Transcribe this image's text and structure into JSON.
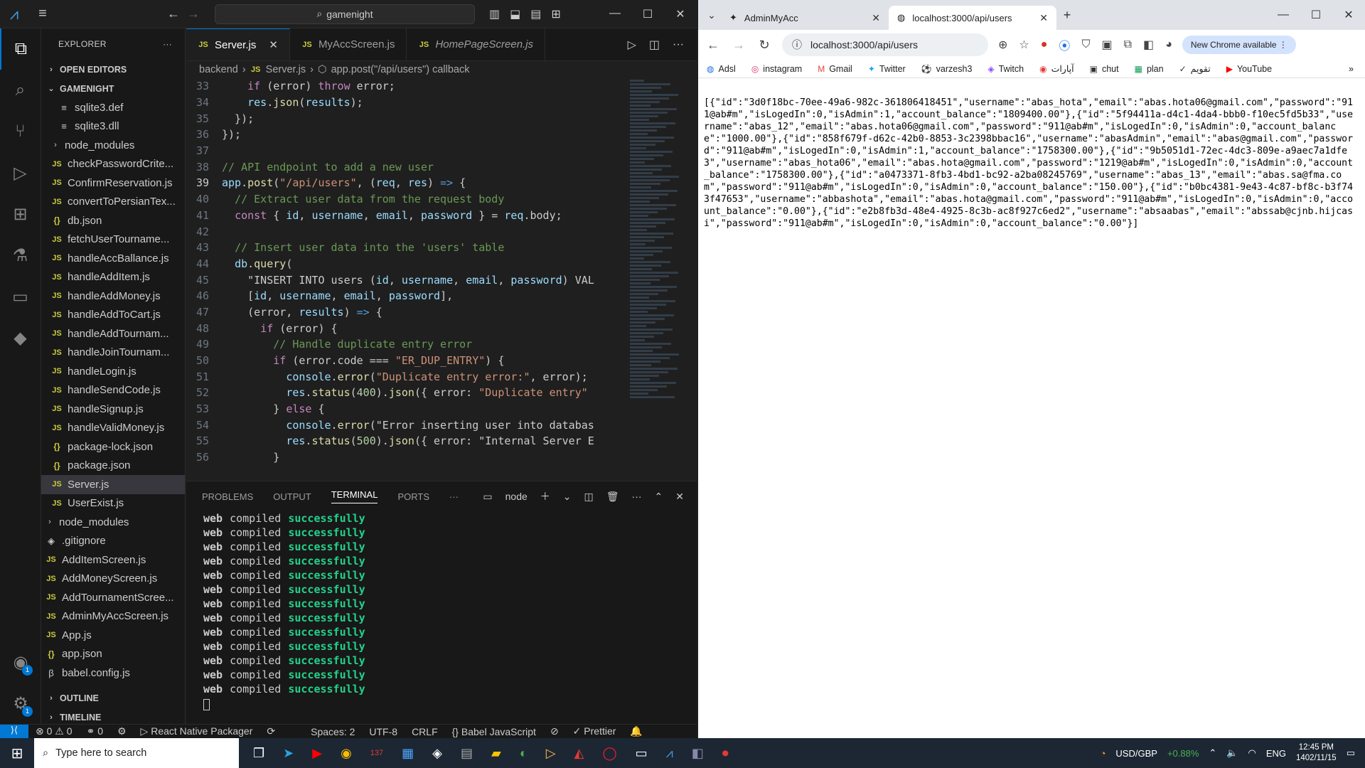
{
  "vscode": {
    "search_text": "gamenight",
    "explorer_title": "EXPLORER",
    "sections": {
      "open_editors": "OPEN EDITORS",
      "project": "GAMENIGHT",
      "outline": "OUTLINE",
      "timeline": "TIMELINE"
    },
    "tree": [
      {
        "name": "sqlite3.def",
        "type": "file",
        "depth": 3
      },
      {
        "name": "sqlite3.dll",
        "type": "file",
        "depth": 3
      },
      {
        "name": "node_modules",
        "type": "folder",
        "depth": 2
      },
      {
        "name": "checkPasswordCrite...",
        "type": "js",
        "depth": 2
      },
      {
        "name": "ConfirmReservation.js",
        "type": "js",
        "depth": 2
      },
      {
        "name": "convertToPersianTex...",
        "type": "js",
        "depth": 2
      },
      {
        "name": "db.json",
        "type": "json",
        "depth": 2
      },
      {
        "name": "fetchUserTourname...",
        "type": "js",
        "depth": 2
      },
      {
        "name": "handleAccBallance.js",
        "type": "js",
        "depth": 2
      },
      {
        "name": "handleAddItem.js",
        "type": "js",
        "depth": 2
      },
      {
        "name": "handleAddMoney.js",
        "type": "js",
        "depth": 2
      },
      {
        "name": "handleAddToCart.js",
        "type": "js",
        "depth": 2
      },
      {
        "name": "handleAddTournam...",
        "type": "js",
        "depth": 2
      },
      {
        "name": "handleJoinTournam...",
        "type": "js",
        "depth": 2
      },
      {
        "name": "handleLogin.js",
        "type": "js",
        "depth": 2
      },
      {
        "name": "handleSendCode.js",
        "type": "js",
        "depth": 2
      },
      {
        "name": "handleSignup.js",
        "type": "js",
        "depth": 2
      },
      {
        "name": "handleValidMoney.js",
        "type": "js",
        "depth": 2
      },
      {
        "name": "package-lock.json",
        "type": "json",
        "depth": 2
      },
      {
        "name": "package.json",
        "type": "json",
        "depth": 2
      },
      {
        "name": "Server.js",
        "type": "js",
        "depth": 2,
        "active": true
      },
      {
        "name": "UserExist.js",
        "type": "js",
        "depth": 2
      },
      {
        "name": "node_modules",
        "type": "folder",
        "depth": 1
      },
      {
        "name": ".gitignore",
        "type": "git",
        "depth": 1
      },
      {
        "name": "AddItemScreen.js",
        "type": "js",
        "depth": 1
      },
      {
        "name": "AddMoneyScreen.js",
        "type": "js",
        "depth": 1
      },
      {
        "name": "AddTournamentScree...",
        "type": "js",
        "depth": 1
      },
      {
        "name": "AdminMyAccScreen.js",
        "type": "js",
        "depth": 1
      },
      {
        "name": "App.js",
        "type": "js",
        "depth": 1
      },
      {
        "name": "app.json",
        "type": "json",
        "depth": 1
      },
      {
        "name": "babel.config.js",
        "type": "babel",
        "depth": 1
      }
    ],
    "tabs": [
      {
        "label": "Server.js",
        "active": true,
        "italic": false
      },
      {
        "label": "MyAccScreen.js",
        "active": false,
        "italic": false
      },
      {
        "label": "HomePageScreen.js",
        "active": false,
        "italic": true
      }
    ],
    "breadcrumb": {
      "folder": "backend",
      "file": "Server.js",
      "symbol": "app.post(\"/api/users\") callback"
    },
    "code_lines": [
      {
        "n": "33",
        "text": "    if (error) throw error;"
      },
      {
        "n": "34",
        "text": "    res.json(results);"
      },
      {
        "n": "35",
        "text": "  });"
      },
      {
        "n": "36",
        "text": "});"
      },
      {
        "n": "37",
        "text": ""
      },
      {
        "n": "38",
        "text": "// API endpoint to add a new user"
      },
      {
        "n": "39",
        "text": "app.post(\"/api/users\", (req, res) => {"
      },
      {
        "n": "40",
        "text": "  // Extract user data from the request body"
      },
      {
        "n": "41",
        "text": "  const { id, username, email, password } = req.body;"
      },
      {
        "n": "42",
        "text": ""
      },
      {
        "n": "43",
        "text": "  // Insert user data into the 'users' table"
      },
      {
        "n": "44",
        "text": "  db.query("
      },
      {
        "n": "45",
        "text": "    \"INSERT INTO users (id, username, email, password) VAL"
      },
      {
        "n": "46",
        "text": "    [id, username, email, password],"
      },
      {
        "n": "47",
        "text": "    (error, results) => {"
      },
      {
        "n": "48",
        "text": "      if (error) {"
      },
      {
        "n": "49",
        "text": "        // Handle duplicate entry error"
      },
      {
        "n": "50",
        "text": "        if (error.code === \"ER_DUP_ENTRY\") {"
      },
      {
        "n": "51",
        "text": "          console.error(\"Duplicate entry error:\", error);"
      },
      {
        "n": "52",
        "text": "          res.status(400).json({ error: \"Duplicate entry\""
      },
      {
        "n": "53",
        "text": "        } else {"
      },
      {
        "n": "54",
        "text": "          console.error(\"Error inserting user into databas"
      },
      {
        "n": "55",
        "text": "          res.status(500).json({ error: \"Internal Server E"
      },
      {
        "n": "56",
        "text": "        }"
      }
    ],
    "current_line": "39",
    "panel_tabs": [
      "PROBLEMS",
      "OUTPUT",
      "TERMINAL",
      "PORTS"
    ],
    "panel_active": "TERMINAL",
    "terminal_shell": "node",
    "terminal_line": {
      "a": "web",
      "b": "compiled",
      "c": "successfully"
    },
    "terminal_count": 13,
    "status": {
      "errors": "0",
      "warnings": "0",
      "ports": "0",
      "packager": "React Native Packager",
      "spaces": "Spaces: 2",
      "encoding": "UTF-8",
      "eol": "CRLF",
      "language": "Babel JavaScript",
      "prettier": "Prettier"
    },
    "accounts_badge": "1",
    "settings_badge": "1"
  },
  "chrome": {
    "tabs": [
      {
        "title": "AdminMyAcc",
        "active": false
      },
      {
        "title": "localhost:3000/api/users",
        "active": true
      }
    ],
    "url": "localhost:3000/api/users",
    "new_chrome_label": "New Chrome available",
    "bookmarks": [
      "Adsl",
      "instagram",
      "Gmail",
      "Twitter",
      "varzesh3",
      "Twitch",
      "آپارات",
      "chut",
      "plan",
      "تقویم",
      "YouTube"
    ],
    "body_text": "[{\"id\":\"3d0f18bc-70ee-49a6-982c-361806418451\",\"username\":\"abas_hota\",\"email\":\"abas.hota06@gmail.com\",\"password\":\"911@ab#m\",\"isLogedIn\":0,\"isAdmin\":1,\"account_balance\":\"1809400.00\"},{\"id\":\"5f94411a-d4c1-4da4-bbb0-f10ec5fd5b33\",\"username\":\"abas_12\",\"email\":\"abas.hota06@gmail.com\",\"password\":\"911@ab#m\",\"isLogedIn\":0,\"isAdmin\":0,\"account_balance\":\"1000.00\"},{\"id\":\"858f679f-d62c-42b0-8853-3c2398bbac16\",\"username\":\"abasAdmin\",\"email\":\"abas@gmail.com\",\"password\":\"911@ab#m\",\"isLogedIn\":0,\"isAdmin\":1,\"account_balance\":\"1758300.00\"},{\"id\":\"9b5051d1-72ec-4dc3-809e-a9aec7a1dfe3\",\"username\":\"abas_hota06\",\"email\":\"abas.hota@gmail.com\",\"password\":\"1219@ab#m\",\"isLogedIn\":0,\"isAdmin\":0,\"account_balance\":\"1758300.00\"},{\"id\":\"a0473371-8fb3-4bd1-bc92-a2ba08245769\",\"username\":\"abas_13\",\"email\":\"abas.sa@fma.com\",\"password\":\"911@ab#m\",\"isLogedIn\":0,\"isAdmin\":0,\"account_balance\":\"150.00\"},{\"id\":\"b0bc4381-9e43-4c87-bf8c-b3f743f47653\",\"username\":\"abbashota\",\"email\":\"abas.hota@gmail.com\",\"password\":\"911@ab#m\",\"isLogedIn\":0,\"isAdmin\":0,\"account_balance\":\"0.00\"},{\"id\":\"e2b8fb3d-48e4-4925-8c3b-ac8f927c6ed2\",\"username\":\"absaabas\",\"email\":\"abssab@cjnb.hijcasi\",\"password\":\"911@ab#m\",\"isLogedIn\":0,\"isAdmin\":0,\"account_balance\":\"0.00\"}]"
  },
  "taskbar": {
    "search_placeholder": "Type here to search",
    "currency": "USD/GBP",
    "currency_change": "+0.88%",
    "lang": "ENG",
    "time": "12:45 PM",
    "date": "1402/11/15",
    "app_badge": "137"
  }
}
